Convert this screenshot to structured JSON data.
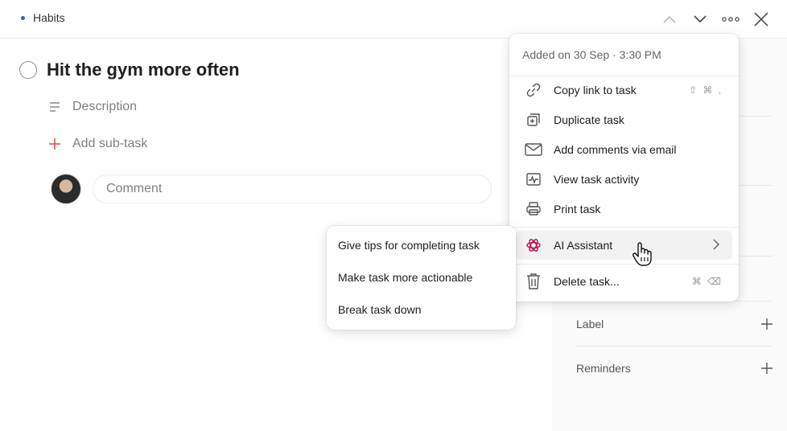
{
  "header": {
    "project": "Habits",
    "project_color": "#2d5fc8"
  },
  "task": {
    "title": "Hit the gym more often",
    "description_placeholder": "Description",
    "add_subtask_label": "Add sub-task",
    "comment_placeholder": "Comment"
  },
  "sidebar": {
    "label_label": "Label",
    "reminders_label": "Reminders"
  },
  "menu": {
    "header": "Added on 30 Sep · 3:30 PM",
    "items": [
      {
        "label": "Copy link to task",
        "icon": "link-icon",
        "shortcut": "⇧ ⌘ ,"
      },
      {
        "label": "Duplicate task",
        "icon": "duplicate-icon"
      },
      {
        "label": "Add comments via email",
        "icon": "email-icon"
      },
      {
        "label": "View task activity",
        "icon": "activity-icon"
      },
      {
        "label": "Print task",
        "icon": "printer-icon"
      },
      {
        "label": "AI Assistant",
        "icon": "ai-assistant-icon",
        "has_submenu": true
      },
      {
        "label": "Delete task...",
        "icon": "trash-icon",
        "shortcut": "⌘ ⌫"
      }
    ]
  },
  "ai_submenu": {
    "items": [
      {
        "label": "Give tips for completing task"
      },
      {
        "label": "Make task more actionable"
      },
      {
        "label": "Break task down"
      }
    ]
  },
  "colors": {
    "accent_red": "#dc4c3e",
    "ai_icon": "#c2185b"
  }
}
